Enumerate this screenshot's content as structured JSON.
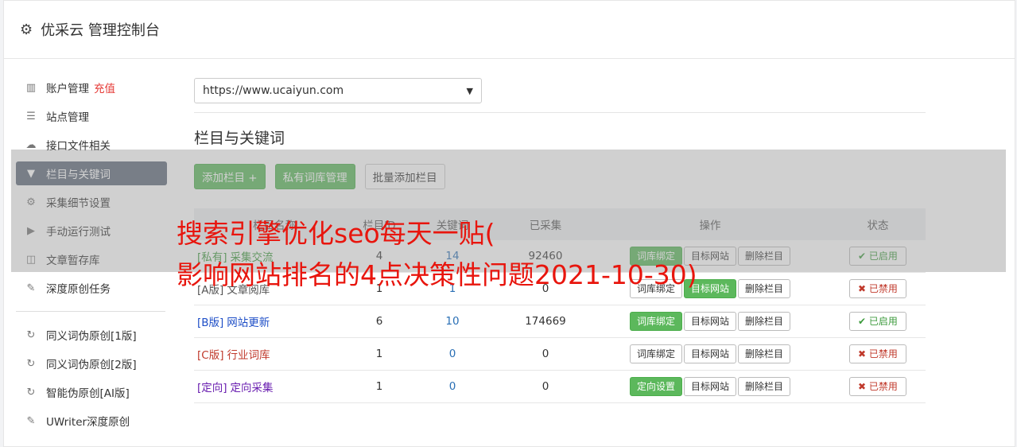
{
  "header": {
    "title": "优采云 管理控制台"
  },
  "sidebar": {
    "items": [
      {
        "label": "账户管理",
        "extra": "充值",
        "icon": "bar-chart-icon",
        "active": false
      },
      {
        "label": "站点管理",
        "icon": "server-icon",
        "active": false
      },
      {
        "label": "接口文件相关",
        "icon": "cloud-upload-icon",
        "active": false
      },
      {
        "label": "栏目与关键词",
        "icon": "filter-icon",
        "active": true
      },
      {
        "label": "采集细节设置",
        "icon": "cogs-icon",
        "active": false
      },
      {
        "label": "手动运行测试",
        "icon": "play-circle-icon",
        "active": false
      },
      {
        "label": "文章暂存库",
        "icon": "database-icon",
        "active": false
      },
      {
        "label": "深度原创任务",
        "icon": "edit-icon",
        "active": false
      }
    ],
    "items2": [
      {
        "label": "同义词伪原创[1版]",
        "icon": "refresh-icon"
      },
      {
        "label": "同义词伪原创[2版]",
        "icon": "refresh-icon"
      },
      {
        "label": "智能伪原创[AI版]",
        "icon": "refresh-icon"
      },
      {
        "label": "UWriter深度原创",
        "icon": "edit-icon"
      }
    ]
  },
  "main": {
    "site_select": "https://www.ucaiyun.com",
    "section_title": "栏目与关键词",
    "buttons": {
      "add": "添加栏目 +",
      "private": "私有词库管理",
      "batch": "批量添加栏目"
    },
    "table": {
      "headers": [
        "栏目名称",
        "栏目ID",
        "关键词",
        "已采集",
        "操作",
        "状态"
      ],
      "rows": [
        {
          "tag": "[私有]",
          "name": "采集交流",
          "tone": "green",
          "id": "4",
          "kw": "14",
          "count": "92460",
          "op1": "词库绑定",
          "op1_green": true,
          "op2": "目标网站",
          "op2_green": false,
          "op3": "删除栏目",
          "status": "已启用",
          "on": true
        },
        {
          "tag": "[A版]",
          "name": "文章阅库",
          "tone": "gray",
          "id": "1",
          "kw": "1",
          "count": "0",
          "op1": "词库绑定",
          "op1_green": false,
          "op2": "目标网站",
          "op2_green": true,
          "op3": "删除栏目",
          "status": "已禁用",
          "on": false
        },
        {
          "tag": "[B版]",
          "name": "网站更新",
          "tone": "blue",
          "id": "6",
          "kw": "10",
          "count": "174669",
          "op1": "词库绑定",
          "op1_green": true,
          "op2": "目标网站",
          "op2_green": false,
          "op3": "删除栏目",
          "status": "已启用",
          "on": true
        },
        {
          "tag": "[C版]",
          "name": "行业词库",
          "tone": "red",
          "id": "1",
          "kw": "0",
          "count": "0",
          "op1": "词库绑定",
          "op1_green": false,
          "op2": "目标网站",
          "op2_green": false,
          "op3": "删除栏目",
          "status": "已禁用",
          "on": false
        },
        {
          "tag": "[定向]",
          "name": "定向采集",
          "tone": "purple",
          "id": "1",
          "kw": "0",
          "count": "0",
          "op1": "定向设置",
          "op1_green": true,
          "op2": "目标网站",
          "op2_green": false,
          "op3": "删除栏目",
          "status": "已禁用",
          "on": false
        }
      ]
    }
  },
  "overlay": {
    "line1": "搜索引擎优化seo每天一贴(",
    "line2": "影响网站排名的4点决策性问题2021-10-30)"
  },
  "colors": {
    "accent_green": "#5cb85c",
    "sidebar_active": "#5f6b7b",
    "overlay_text": "#e8150d"
  }
}
